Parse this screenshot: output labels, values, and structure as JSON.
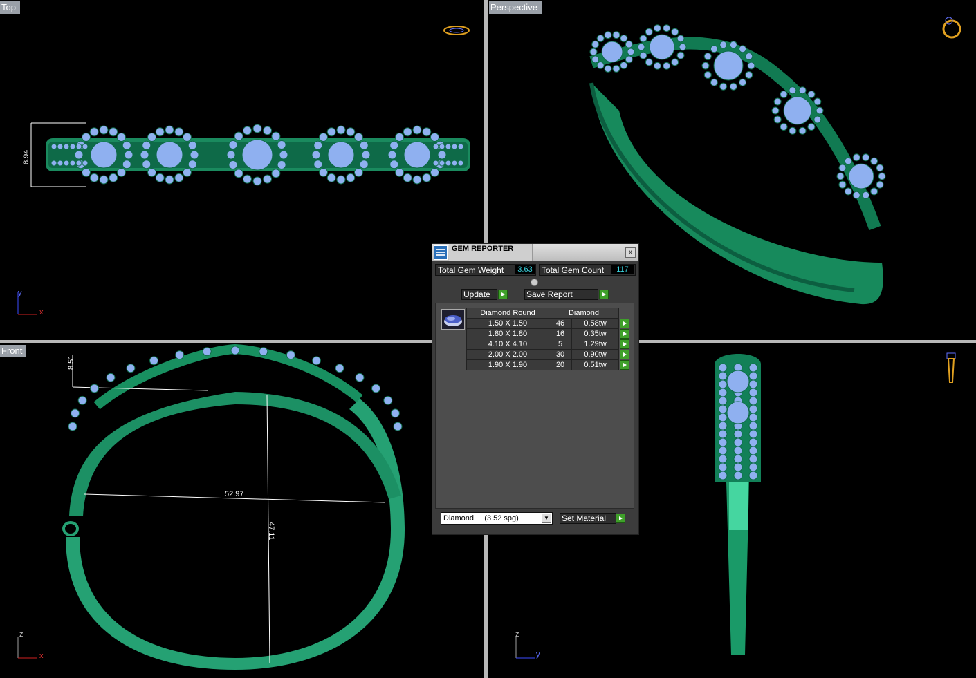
{
  "viewports": {
    "top": {
      "label": "Top",
      "dim_height": "8.94",
      "axis_a": "y",
      "axis_b": "x"
    },
    "perspective": {
      "label": "Perspective"
    },
    "front": {
      "label": "Front",
      "dim_top": "8.51",
      "dim_width": "52.97",
      "dim_height": "47.11",
      "axis_a": "z",
      "axis_b": "x"
    },
    "right": {
      "axis_a": "z",
      "axis_b": "y"
    }
  },
  "gem_reporter": {
    "title": "GEM REPORTER",
    "close": "x",
    "total_weight_label": "Total Gem Weight",
    "total_weight_value": "3.63",
    "total_count_label": "Total Gem Count",
    "total_count_value": "117",
    "update_label": "Update",
    "save_report_label": "Save Report",
    "table_headers": [
      "Diamond Round",
      "Diamond"
    ],
    "rows": [
      {
        "size": "1.50 X 1.50",
        "count": "46",
        "weight": "0.58tw"
      },
      {
        "size": "1.80 X 1.80",
        "count": "16",
        "weight": "0.35tw"
      },
      {
        "size": "4.10 X 4.10",
        "count": "5",
        "weight": "1.29tw"
      },
      {
        "size": "2.00 X 2.00",
        "count": "30",
        "weight": "0.90tw"
      },
      {
        "size": "1.90 X 1.90",
        "count": "20",
        "weight": "0.51tw"
      }
    ],
    "material_value": "Diamond     (3.52 spg)",
    "set_material_label": "Set Material"
  },
  "colors": {
    "metal": "#1f9a6a",
    "metal_dark": "#0e6a48",
    "gem": "#8fb0f0",
    "gem_dark": "#5a7fd0",
    "value_text": "#39d5e0"
  }
}
